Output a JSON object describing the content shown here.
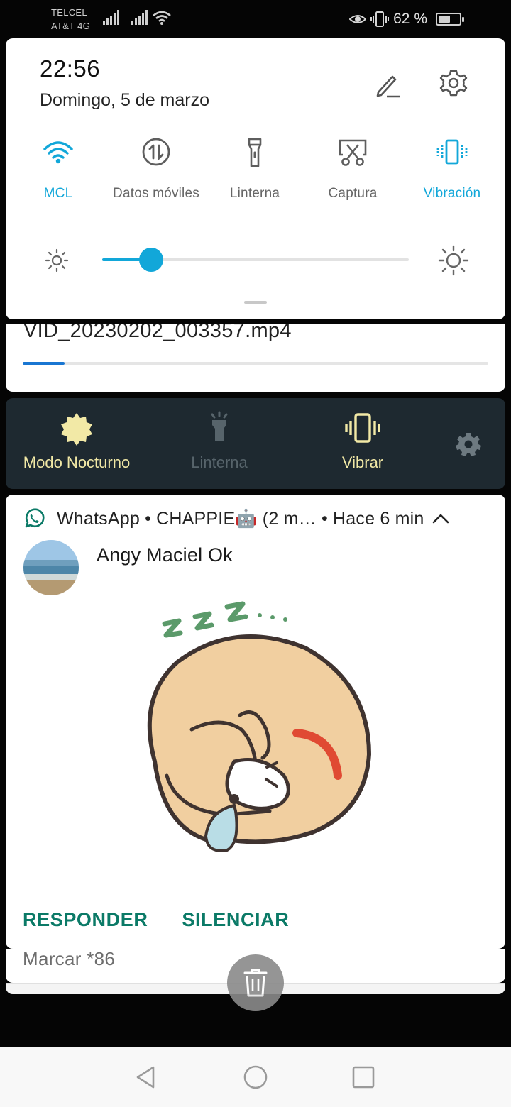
{
  "status": {
    "carrier_line1": "TELCEL",
    "carrier_line2": "AT&T 4G",
    "battery_pct_text": "62 %",
    "battery_level": 0.62,
    "icons": [
      "signal-icon",
      "signal-icon",
      "wifi-icon",
      "eye-icon",
      "vibrate-icon",
      "battery-icon"
    ]
  },
  "quick_settings": {
    "time": "22:56",
    "date": "Domingo, 5 de marzo",
    "tiles": [
      {
        "label": "MCL",
        "icon": "wifi-icon",
        "active": true
      },
      {
        "label": "Datos móviles",
        "icon": "mobile-data-icon",
        "active": false
      },
      {
        "label": "Linterna",
        "icon": "flashlight-icon",
        "active": false
      },
      {
        "label": "Captura",
        "icon": "screenshot-icon",
        "active": false
      },
      {
        "label": "Vibración",
        "icon": "vibrate-icon",
        "active": true
      }
    ],
    "brightness_level": 0.16,
    "accent_color": "#12a7d9"
  },
  "file_notification": {
    "name": "VID_20230202_003357.mp4",
    "progress": 0.09
  },
  "shortcuts": {
    "items": [
      {
        "label": "Modo Nocturno",
        "icon": "night-mode-icon",
        "color": "#f2e9a6"
      },
      {
        "label": "Linterna",
        "icon": "flashlight-icon",
        "color": "#57646b"
      },
      {
        "label": "Vibrar",
        "icon": "vibrate-icon",
        "color": "#f2e9a6"
      }
    ]
  },
  "whatsapp": {
    "header": "WhatsApp • CHAPPIE🤖 (2 m… • Hace 6 min",
    "sender": "Angy Maciel Ok",
    "actions": {
      "reply": "RESPONDER",
      "mute": "SILENCIAR"
    },
    "brand_color": "#0b7a67"
  },
  "stacked": {
    "text": "Marcar *86"
  }
}
